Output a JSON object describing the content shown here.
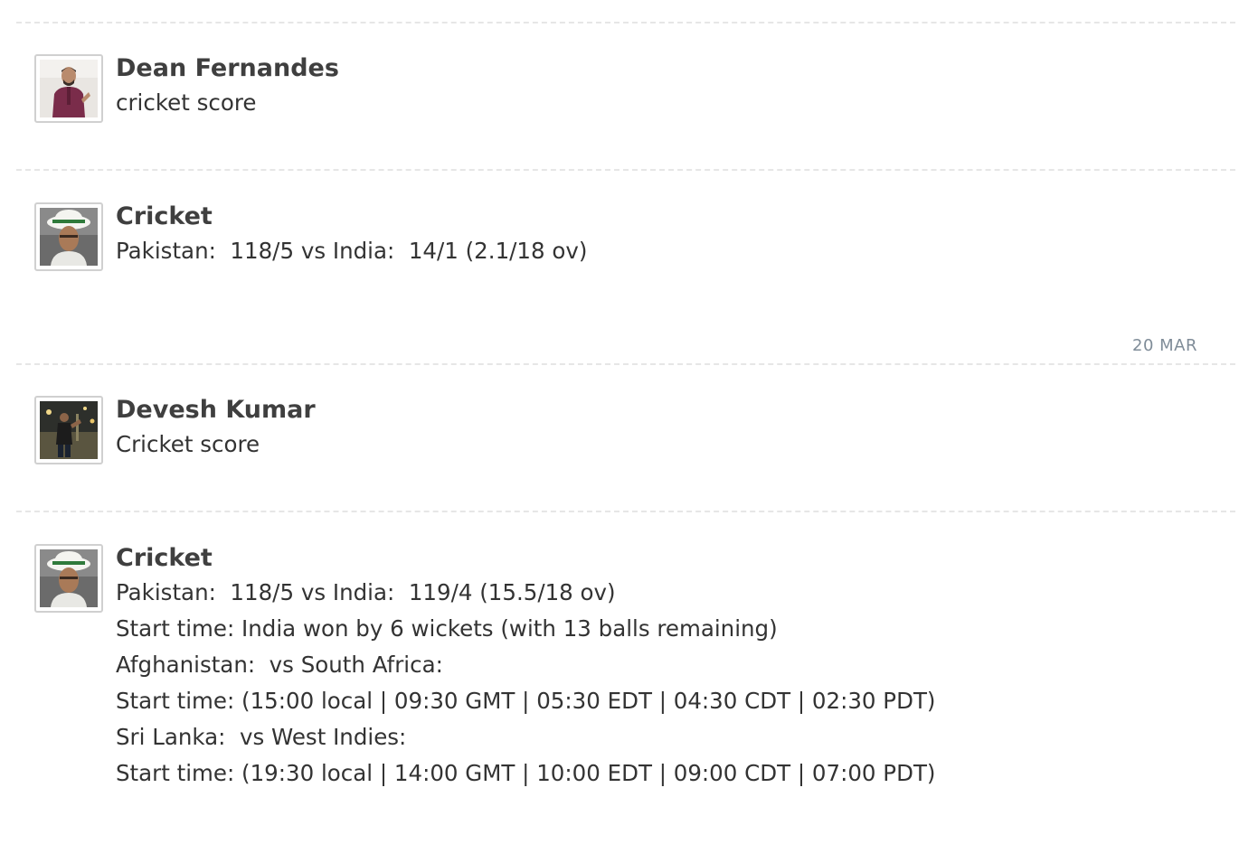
{
  "messages": [
    {
      "sender": "Dean Fernandes",
      "avatar_icon": "user-photo-man-maroon-shirt",
      "lines": [
        "cricket score"
      ]
    },
    {
      "sender": "Cricket",
      "avatar_icon": "cricket-player-white-hat",
      "lines": [
        "Pakistan:  118/5 vs India:  14/1 (2.1/18 ov)"
      ]
    },
    {
      "sender": "Devesh Kumar",
      "avatar_icon": "user-photo-night-street",
      "lines": [
        "Cricket score"
      ]
    },
    {
      "sender": "Cricket",
      "avatar_icon": "cricket-player-white-hat",
      "lines": [
        "Pakistan:  118/5 vs India:  119/4 (15.5/18 ov)",
        "Start time: India won by 6 wickets (with 13 balls remaining)",
        "Afghanistan:  vs South Africa:",
        "Start time: (15:00 local | 09:30 GMT | 05:30 EDT | 04:30 CDT | 02:30 PDT)",
        "Sri Lanka:  vs West Indies:",
        "Start time: (19:30 local | 14:00 GMT | 10:00 EDT | 09:00 CDT | 07:00 PDT)"
      ]
    }
  ],
  "date_separator": "20 MAR"
}
